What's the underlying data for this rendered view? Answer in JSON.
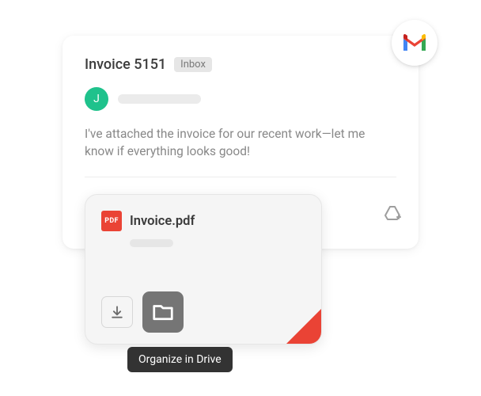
{
  "email": {
    "subject": "Invoice 5151",
    "tag": "Inbox",
    "avatar_initial": "J",
    "body": "I've attached the invoice for our recent work—let me know if everything looks good!"
  },
  "attachment": {
    "pdf_badge": "PDF",
    "filename": "Invoice.pdf"
  },
  "tooltip": {
    "text": "Organize in Drive"
  }
}
